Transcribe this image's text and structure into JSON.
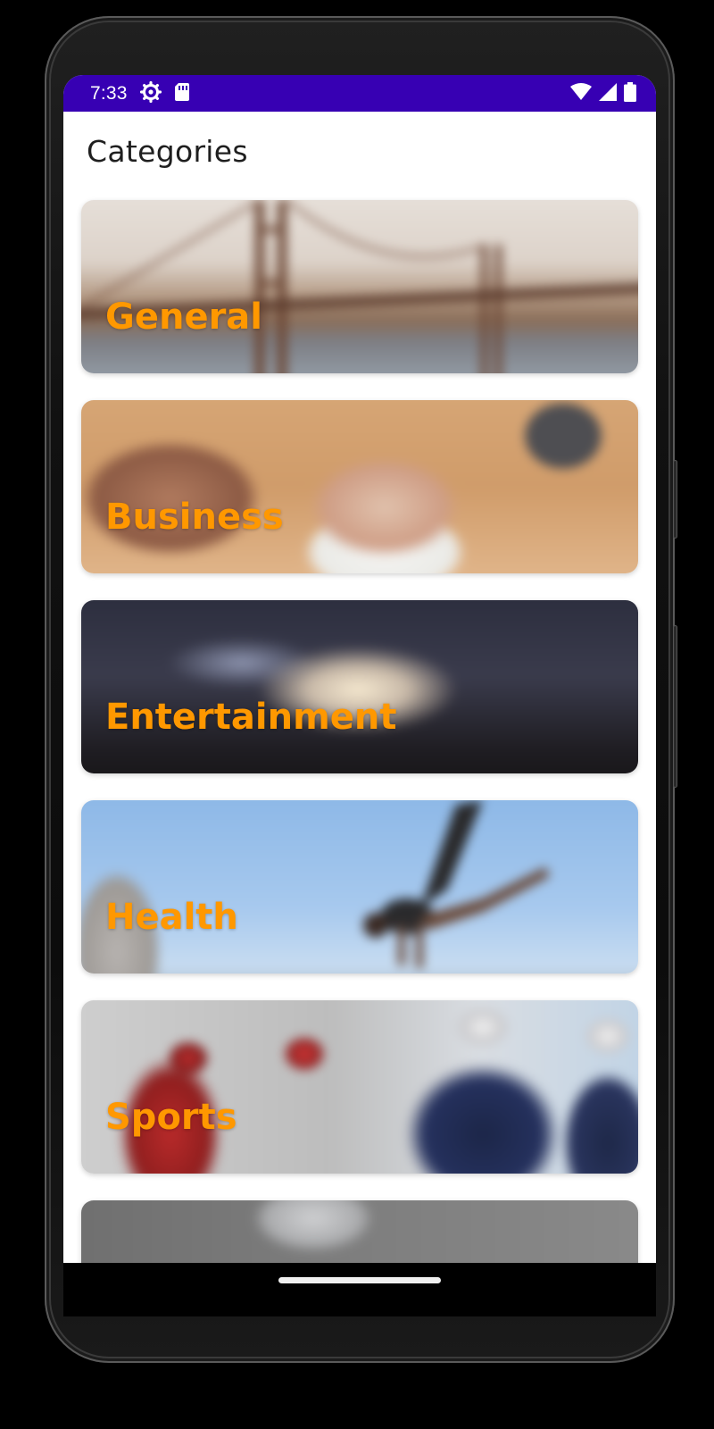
{
  "status_bar": {
    "time": "7:33",
    "left_icons": [
      "settings-icon",
      "sim-card-icon"
    ],
    "right_icons": [
      "wifi-icon",
      "signal-icon",
      "battery-icon"
    ],
    "color": "#3700b3"
  },
  "page": {
    "title": "Categories"
  },
  "categories": [
    {
      "label": "General"
    },
    {
      "label": "Business"
    },
    {
      "label": "Entertainment"
    },
    {
      "label": "Health"
    },
    {
      "label": "Sports"
    },
    {
      "label": ""
    }
  ],
  "colors": {
    "accent_label": "#ff9800",
    "status_bar": "#3700b3"
  }
}
